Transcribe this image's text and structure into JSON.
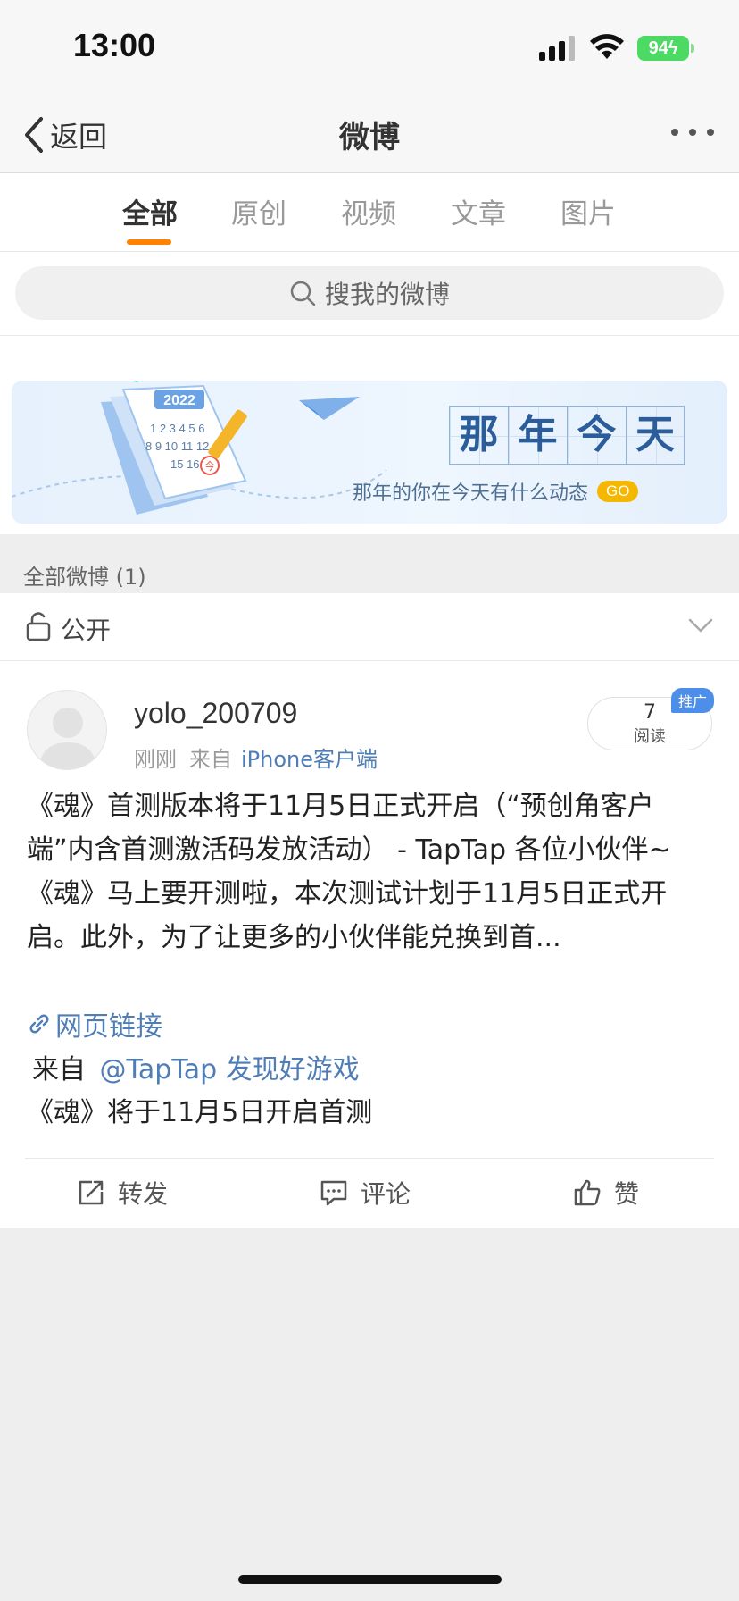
{
  "status_bar": {
    "time": "13:00",
    "battery": "94"
  },
  "nav": {
    "back_label": "返回",
    "title": "微博"
  },
  "tabs": [
    {
      "label": "全部",
      "active": true
    },
    {
      "label": "原创",
      "active": false
    },
    {
      "label": "视频",
      "active": false
    },
    {
      "label": "文章",
      "active": false
    },
    {
      "label": "图片",
      "active": false
    }
  ],
  "search": {
    "placeholder": "搜我的微博"
  },
  "banner": {
    "title_chars": [
      "那",
      "年",
      "今",
      "天"
    ],
    "subtitle": "那年的你在今天有什么动态",
    "go_label": "GO",
    "year": "2022",
    "calendar_today": "今"
  },
  "section": {
    "label": "全部微博 (1)"
  },
  "visibility": {
    "label": "公开"
  },
  "post": {
    "username": "yolo_200709",
    "time_ago": "刚刚",
    "source_prefix": "来自",
    "source": "iPhone客户端",
    "read_count": "7",
    "read_label": "阅读",
    "promo_badge": "推广",
    "text": "《魂》首测版本将于11月5日正式开启（“预创角客户端”内含首测激活码发放活动） - TapTap 各位小伙伴~《魂》马上要开测啦，本次测试计划于11月5日正式开启。此外，为了让更多的小伙伴能兑换到首...",
    "link_label": "网页链接",
    "from_prefix": "来自",
    "from_mention": "@TapTap 发现好游戏",
    "headline": "《魂》将于11月5日开启首测"
  },
  "actions": {
    "repost": "转发",
    "comment": "评论",
    "like": "赞"
  },
  "colors": {
    "accent": "#ff8200",
    "link": "#4f7db5",
    "battery": "#4cd964",
    "go_badge": "#f5b700",
    "promo": "#4d8fe8"
  }
}
